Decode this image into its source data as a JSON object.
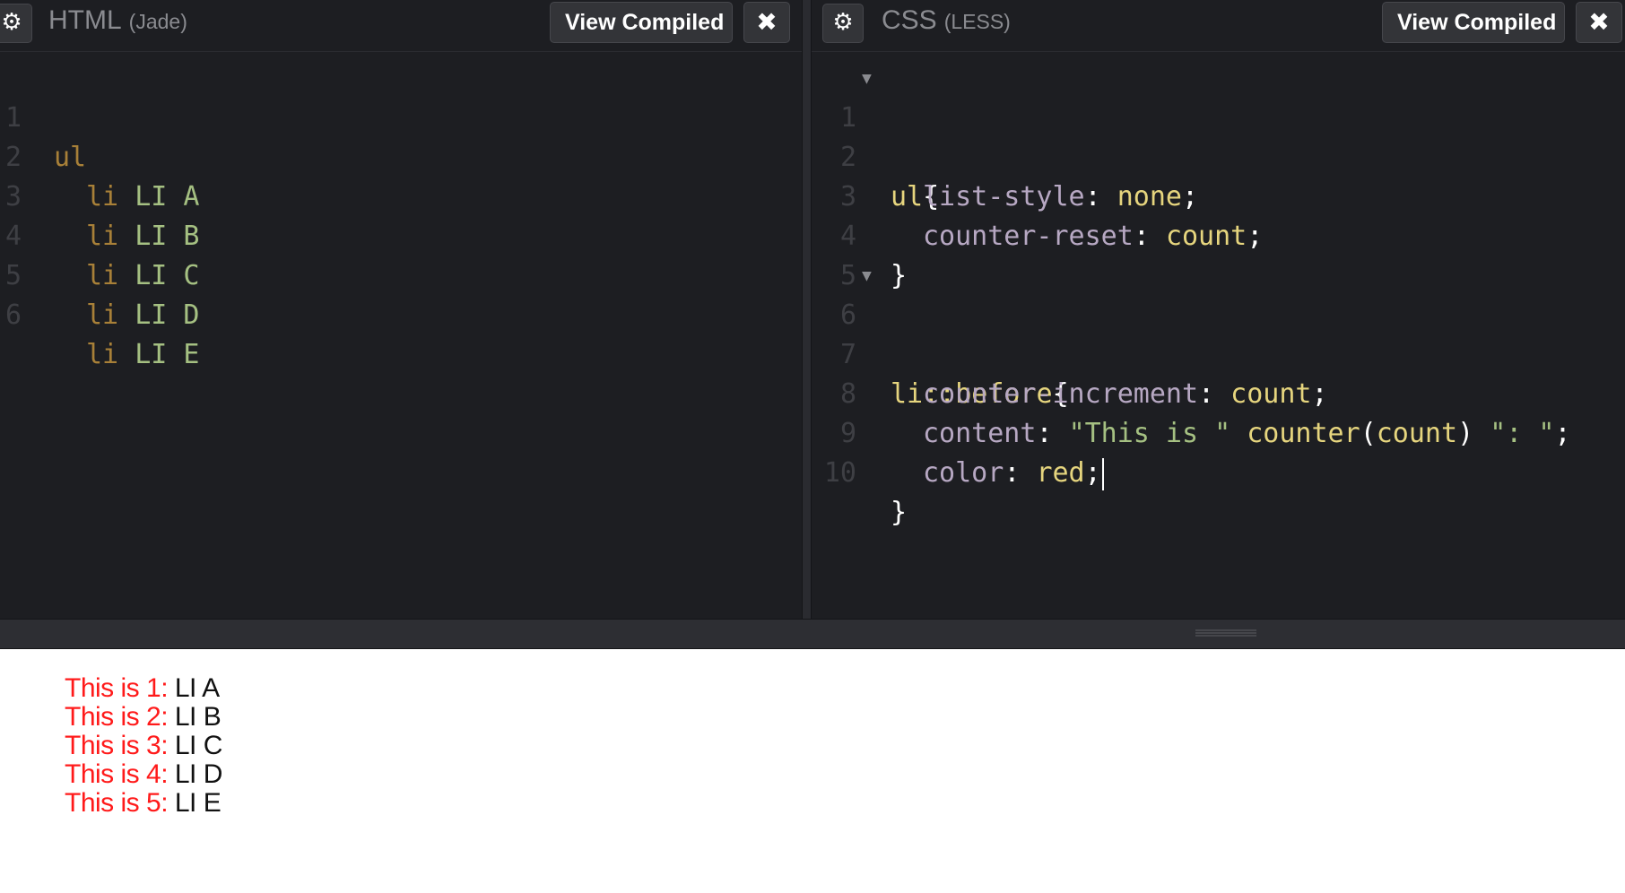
{
  "html_pane": {
    "title": "HTML",
    "subtitle": "(Jade)",
    "view_compiled_label": "View Compiled",
    "close_label": "✖",
    "lines": [
      {
        "n": "1",
        "tag": "ul",
        "text": ""
      },
      {
        "n": "2",
        "tag": "li",
        "text": "LI A"
      },
      {
        "n": "3",
        "tag": "li",
        "text": "LI B"
      },
      {
        "n": "4",
        "tag": "li",
        "text": "LI C"
      },
      {
        "n": "5",
        "tag": "li",
        "text": "LI D"
      },
      {
        "n": "6",
        "tag": "li",
        "text": "LI E"
      }
    ]
  },
  "css_pane": {
    "title": "CSS",
    "subtitle": "(LESS)",
    "view_compiled_label": "View Compiled",
    "close_label": "✖",
    "line_numbers": [
      "1",
      "2",
      "3",
      "4",
      "5",
      "6",
      "7",
      "8",
      "9",
      "10"
    ],
    "selector_1": "ul",
    "brace_open": "{",
    "brace_close": "}",
    "prop_list_style": "list-style",
    "val_none": "none",
    "prop_counter_reset": "counter-reset",
    "val_count": "count",
    "selector_2": "li::before",
    "prop_counter_increment": "counter-increment",
    "prop_content": "content",
    "str_this_is": "\"This is \"",
    "fn_counter": "counter",
    "str_colon": "\": \"",
    "prop_color": "color",
    "val_red": "red"
  },
  "preview": {
    "items": [
      {
        "prefix": "This is 1: ",
        "text": "LI A"
      },
      {
        "prefix": "This is 2: ",
        "text": "LI B"
      },
      {
        "prefix": "This is 3: ",
        "text": "LI C"
      },
      {
        "prefix": "This is 4: ",
        "text": "LI D"
      },
      {
        "prefix": "This is 5: ",
        "text": "LI E"
      }
    ]
  },
  "colors": {
    "editor_bg": "#1d1e22",
    "tag": "#a88038",
    "text": "#a5c082",
    "property": "#b7a8c3",
    "value": "#e6d57e",
    "preview_prefix": "#ff1a1a"
  },
  "icons": {
    "settings": "gear-icon",
    "close": "close-icon",
    "fold": "fold-arrow-icon",
    "resize": "grip-icon"
  }
}
